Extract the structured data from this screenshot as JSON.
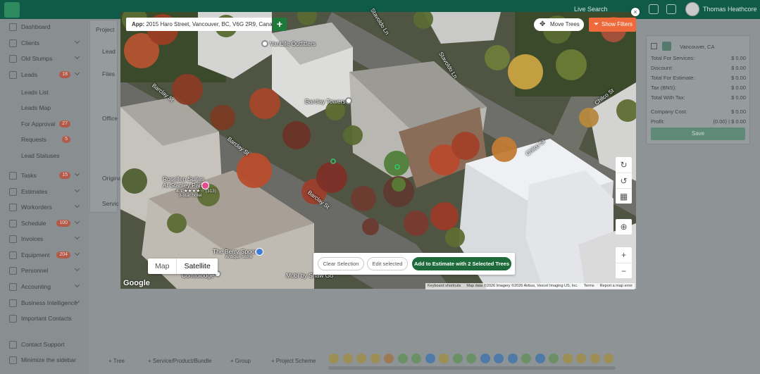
{
  "header": {
    "live_search": "Live Search",
    "user_name": "Thomas Heathcore"
  },
  "sidebar": {
    "items": [
      {
        "label": "Dashboard",
        "icon": "dashboard-icon"
      },
      {
        "label": "Clients",
        "icon": "clients-icon"
      },
      {
        "label": "Old Stumps",
        "icon": "stumps-icon"
      },
      {
        "label": "Leads",
        "icon": "leads-icon",
        "badge": "18"
      },
      {
        "label": "Leads List",
        "sub": true
      },
      {
        "label": "Leads Map",
        "sub": true
      },
      {
        "label": "For Approval",
        "sub": true,
        "badge": "27"
      },
      {
        "label": "Requests",
        "sub": true,
        "badge": "5"
      },
      {
        "label": "Lead Statuses",
        "sub": true
      },
      {
        "label": "Tasks",
        "icon": "tasks-icon",
        "badge": "15"
      },
      {
        "label": "Estimates",
        "icon": "estimates-icon"
      },
      {
        "label": "Workorders",
        "icon": "workorders-icon"
      },
      {
        "label": "Schedule",
        "icon": "schedule-icon",
        "badge": "100"
      },
      {
        "label": "Invoices",
        "icon": "invoices-icon"
      },
      {
        "label": "Equipment",
        "icon": "equipment-icon",
        "badge": "204"
      },
      {
        "label": "Personnel",
        "icon": "personnel-icon"
      },
      {
        "label": "Accounting",
        "icon": "accounting-icon"
      },
      {
        "label": "Business Intelligence",
        "icon": "bi-icon"
      },
      {
        "label": "Important Contacts",
        "icon": "contacts-icon"
      },
      {
        "label": "Contact Support",
        "icon": "support-icon"
      },
      {
        "label": "Minimize the sidebar",
        "icon": "minimize-icon"
      }
    ]
  },
  "background": {
    "project_label": "Project",
    "lead_label": "Lead",
    "files_label": "Files",
    "office_label": "Office",
    "original_label": "Origina",
    "service_label": "Servic",
    "location": "Vancouver, CA",
    "summary": [
      {
        "label": "Total For Services:",
        "value": "$ 0.00"
      },
      {
        "label": "Discount:",
        "value": "$ 0.00"
      },
      {
        "label": "Total For Estimate:",
        "value": "$ 0.00"
      },
      {
        "label": "Tax (BNS):",
        "value": "$ 0.00"
      },
      {
        "label": "Total With Tax:",
        "value": "$ 0.00"
      },
      {
        "label": "Company Cost:",
        "value": "$ 0.00"
      },
      {
        "label": "Profit:",
        "value": "(0.00) | $ 0.00"
      }
    ],
    "save_label": "Save",
    "bottom_tabs": [
      "+ Tree",
      "+ Service/Product/Bundle",
      "+ Group",
      "+ Project Scheme"
    ]
  },
  "modal": {
    "address_prefix": "App:",
    "address": "2015 Haro Street, Vancouver, BC, V6G 2R9, Canada",
    "add_label": "+",
    "close_label": "×",
    "move_trees_label": "Move Trees",
    "show_filters_label": "Show Filters",
    "map_labels": {
      "vanlife": "VanLife Outfitters",
      "barclay_towers": "Barclay Towers",
      "rosellen_name": "Rosellen Suites",
      "rosellen_name2": "At Stanley Park",
      "rosellen_rating": "4.1 ★★★★☆ (313)",
      "rosellen_type": "3-star hotel",
      "berry_spoon": "The Berry Spoon",
      "berry_type": "Antique store",
      "comfolodge": "Comfolodge",
      "mobi": "Mobi by Shaw Go"
    },
    "streets": {
      "stavoldo_1": "Stavoldo Ln",
      "stavoldo_2": "Stavoldo Ln",
      "barclay_1": "Barclay St",
      "barclay_2": "Barclay St",
      "barclay_3": "Barclay St",
      "chilco_1": "Chilco St",
      "chilco_2": "Chilco St"
    },
    "map_type": {
      "map": "Map",
      "satellite": "Satellite",
      "selected": "Satellite"
    },
    "actions": {
      "clear": "Clear Selection",
      "edit": "Edit selected",
      "add_estimate": "Add to Estimate with 2 Selected Trees"
    },
    "zoom_in": "+",
    "zoom_out": "−",
    "google": "Google",
    "attribution": [
      "Keyboard shortcuts",
      "Map data ©2026 Imagery ©2026 Airbus, Vexcel Imaging US, Inc.",
      "Terms",
      "Report a map error"
    ]
  },
  "colors": {
    "header": "#0f5b47",
    "primary_action": "#1d6b3a",
    "filters": "#ef6a3a"
  }
}
